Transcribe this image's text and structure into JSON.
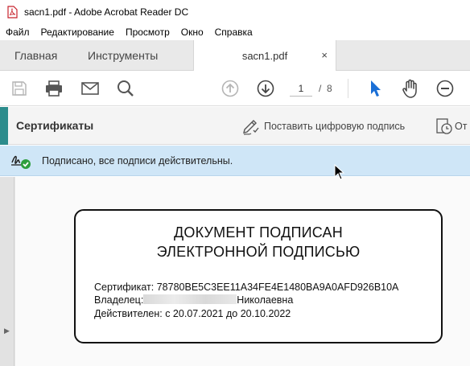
{
  "window": {
    "title": "sacn1.pdf - Adobe Acrobat Reader DC"
  },
  "menu": [
    "Файл",
    "Редактирование",
    "Просмотр",
    "Окно",
    "Справка"
  ],
  "tabs": {
    "home": "Главная",
    "tools": "Инструменты",
    "document": "sacn1.pdf",
    "close_glyph": "×"
  },
  "toolbar": {
    "icons": [
      "save-icon",
      "print-icon",
      "email-icon",
      "search-icon",
      "page-up-icon",
      "page-down-icon",
      "select-cursor-icon",
      "hand-icon",
      "zoom-out-icon"
    ],
    "current_page": "1",
    "page_separator": "/",
    "total_pages": "8"
  },
  "certificates": {
    "title": "Сертификаты",
    "sign_label": "Поставить цифровую подпись",
    "cut_label": "От"
  },
  "status": {
    "text": "Подписано, все подписи действительны.",
    "color": "#cfe6f7"
  },
  "stamp": {
    "heading_line1": "ДОКУМЕНТ ПОДПИСАН",
    "heading_line2": "ЭЛЕКТРОННОЙ ПОДПИСЬЮ",
    "certificate": "Сертификат: 78780BE5C3EE11A34FE4E1480BA9A0AFD926B10A",
    "owner_label": "Владелец:",
    "owner_visible": "Николаевна",
    "validity": "Действителен: с 20.07.2021 до 20.10.2022"
  },
  "colors": {
    "accent": "#2c8c8c",
    "select_blue": "#1a6fd6"
  }
}
